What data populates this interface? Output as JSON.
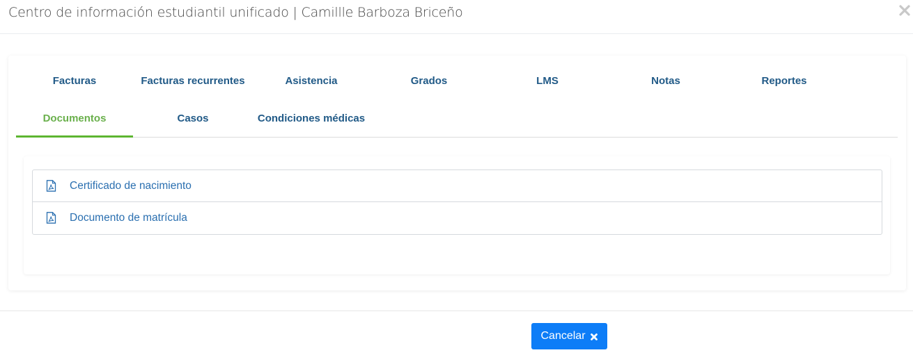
{
  "header": {
    "title": "Centro de información estudiantil unificado | Camillle Barboza Briceño",
    "close_icon": "times-icon"
  },
  "tabs": {
    "row1": [
      "Facturas",
      "Facturas recurrentes",
      "Asistencia",
      "Grados",
      "LMS",
      "Notas",
      "Reportes"
    ],
    "row2": [
      "Documentos",
      "Casos",
      "Condiciones médicas"
    ],
    "active": "Documentos",
    "active_color": "#6ab04c",
    "inactive_color": "#215a87"
  },
  "documents": [
    {
      "label": "Certificado de nacimiento",
      "icon": "file-pdf-icon"
    },
    {
      "label": "Documento de matrícula",
      "icon": "file-pdf-icon"
    }
  ],
  "footer": {
    "cancel_label": "Cancelar",
    "cancel_icon": "times-icon",
    "button_color": "#0d7df7"
  }
}
